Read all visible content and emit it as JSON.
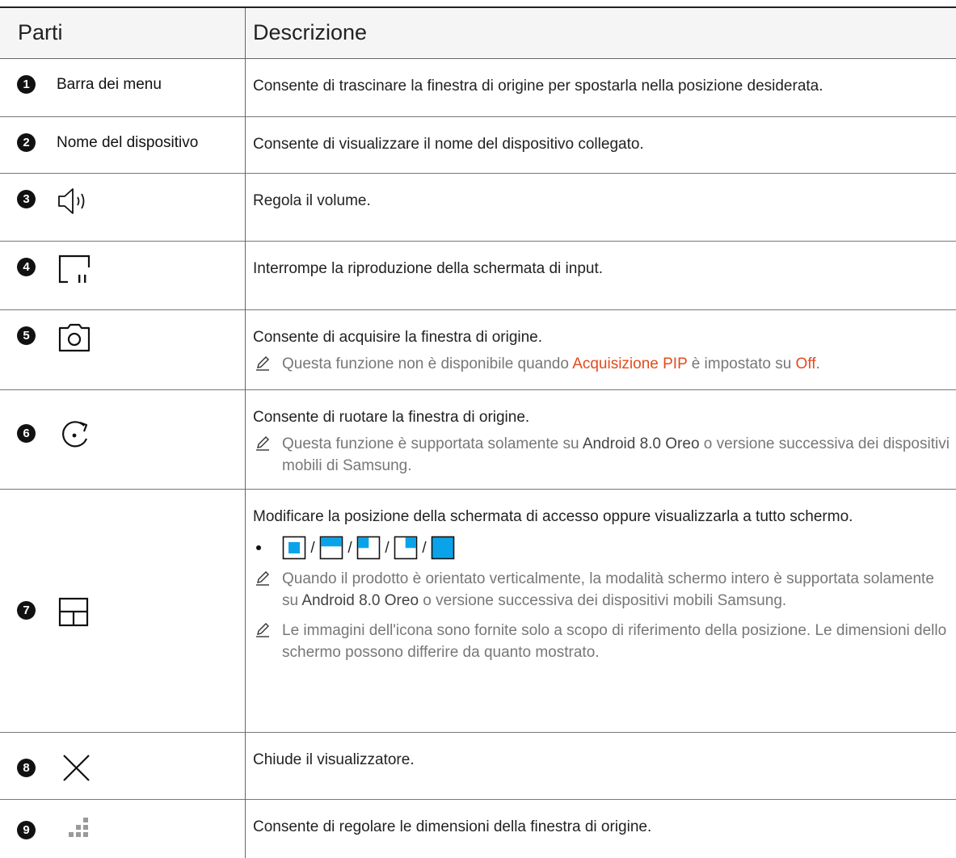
{
  "header": {
    "col1": "Parti",
    "col2": "Descrizione"
  },
  "rows": [
    {
      "num": "1",
      "label": "Barra dei menu",
      "desc": "Consente di trascinare la finestra di origine per spostarla nella posizione desiderata."
    },
    {
      "num": "2",
      "label": "Nome del dispositivo",
      "desc": "Consente di visualizzare il nome del dispositivo collegato."
    },
    {
      "num": "3",
      "icon": "volume-icon",
      "desc": "Regola il volume."
    },
    {
      "num": "4",
      "icon": "pause-screen-icon",
      "desc": "Interrompe la riproduzione della schermata di input."
    },
    {
      "num": "5",
      "icon": "camera-icon",
      "desc": "Consente di acquisire la finestra di origine.",
      "note": {
        "pre": "Questa funzione non è disponibile quando ",
        "hl1": "Acquisizione PIP",
        "mid": " è impostato su ",
        "hl2": "Off",
        "post": "."
      }
    },
    {
      "num": "6",
      "icon": "rotate-icon",
      "desc": "Consente di ruotare la finestra di origine.",
      "note": {
        "pre": "Questa funzione è supportata solamente su ",
        "b1": "Android 8.0 Oreo",
        "post": " o versione successiva dei dispositivi mobili di Samsung."
      }
    },
    {
      "num": "7",
      "icon": "layout-icon",
      "desc": "Modificare la posizione della schermata di accesso oppure visualizzarla a tutto schermo.",
      "bullet_sep": "/",
      "position_icons": [
        "center-window-icon",
        "top-window-icon",
        "top-left-window-icon",
        "top-right-window-icon",
        "full-screen-icon"
      ],
      "note1": {
        "pre": "Quando il prodotto è orientato verticalmente, la modalità schermo intero è supportata solamente su ",
        "b1": "Android 8.0 Oreo",
        "post": " o versione successiva dei dispositivi mobili Samsung."
      },
      "note2": "Le immagini dell'icona sono fornite solo a scopo di riferimento della posizione. Le dimensioni dello schermo possono differire da quanto mostrato."
    },
    {
      "num": "8",
      "icon": "close-icon",
      "desc": "Chiude il visualizzatore."
    },
    {
      "num": "9",
      "icon": "resize-icon",
      "desc": "Consente di regolare le dimensioni della finestra di origine."
    }
  ],
  "colors": {
    "accent": "#e34b1c",
    "position_blue": "#0aa3ea"
  }
}
